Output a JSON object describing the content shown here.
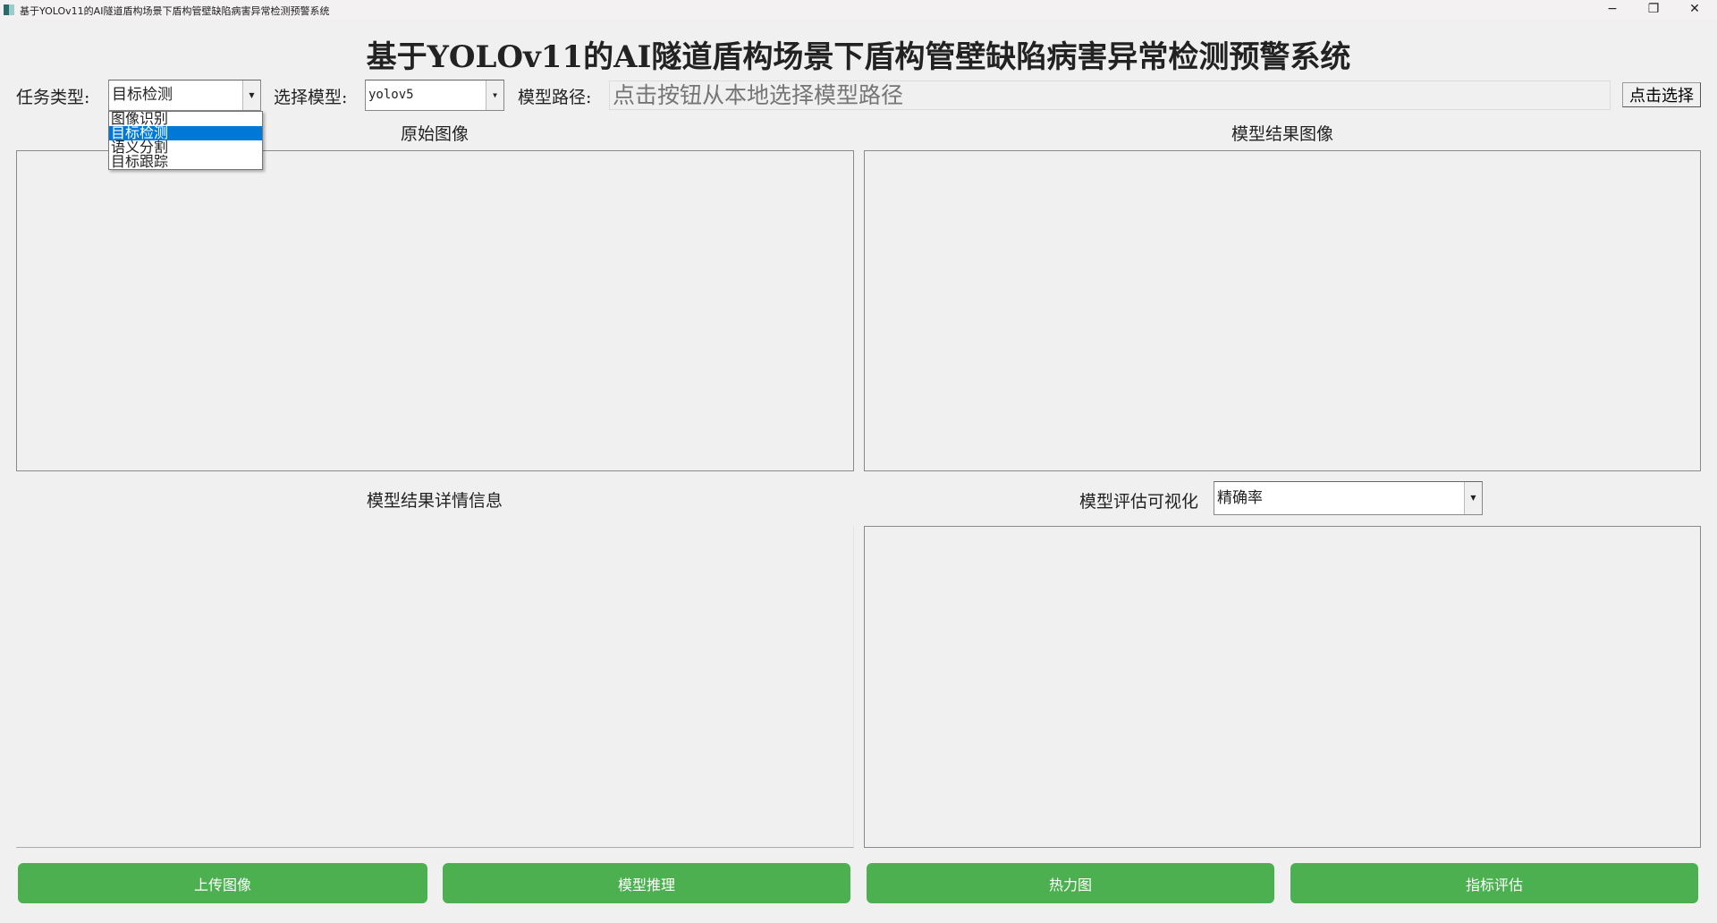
{
  "window": {
    "title": "基于YOLOv11的AI隧道盾构场景下盾构管壁缺陷病害异常检测预警系统",
    "minimize": "−",
    "maximize": "❐",
    "close": "✕"
  },
  "header": {
    "title": "基于YOLOv11的AI隧道盾构场景下盾构管壁缺陷病害异常检测预警系统"
  },
  "controls": {
    "task_label": "任务类型:",
    "task_value": "目标检测",
    "task_options": [
      "图像识别",
      "目标检测",
      "语义分割",
      "目标跟踪"
    ],
    "model_label": "选择模型:",
    "model_value": "yolov5",
    "path_label": "模型路径:",
    "path_placeholder": "点击按钮从本地选择模型路径",
    "choose_button": "点击选择"
  },
  "panels": {
    "original": "原始图像",
    "result": "模型结果图像",
    "details": "模型结果详情信息",
    "eval_label": "模型评估可视化",
    "eval_value": "精确率"
  },
  "buttons": {
    "upload": "上传图像",
    "infer": "模型推理",
    "heatmap": "热力图",
    "metrics": "指标评估"
  }
}
